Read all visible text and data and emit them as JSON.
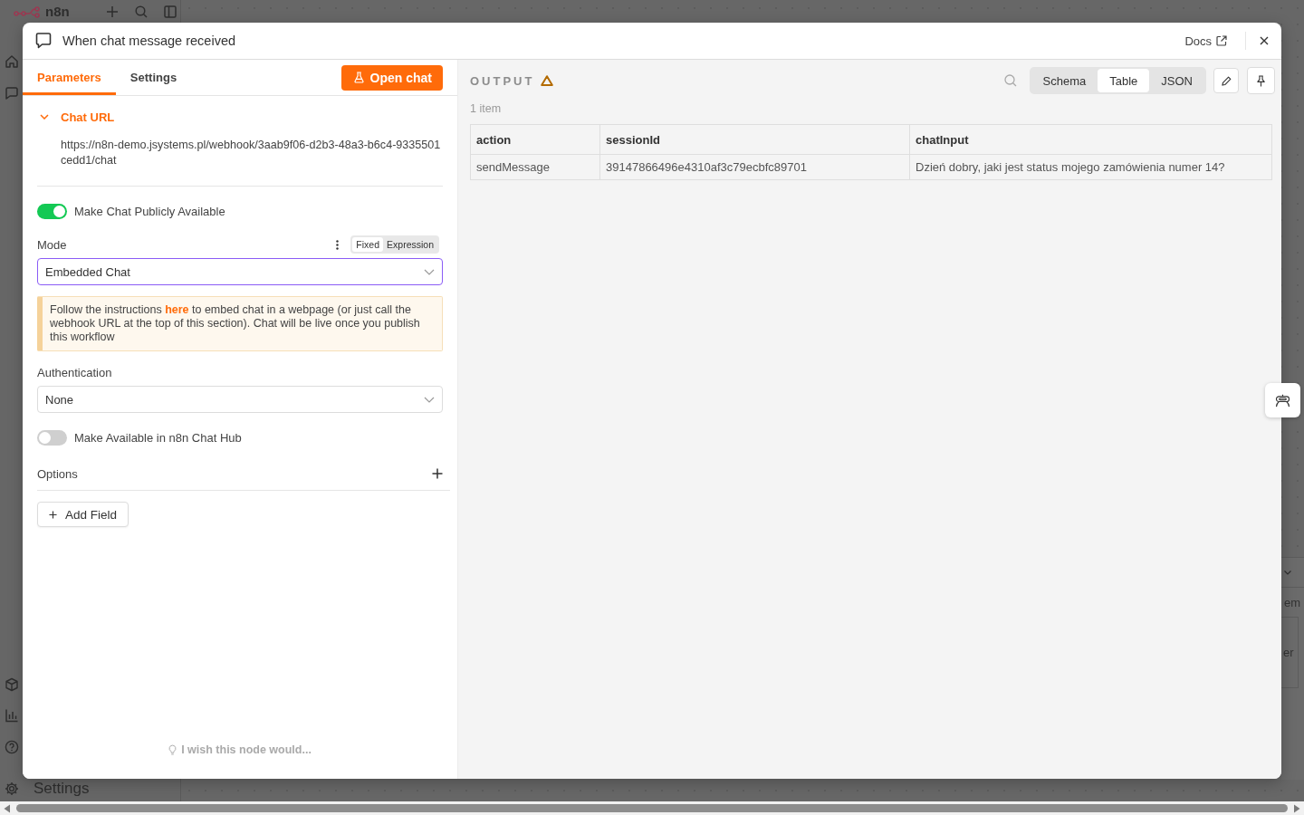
{
  "background": {
    "app_name": "n8n",
    "sidebar_item": "Settings",
    "canvas_fragments": [
      "em",
      "er"
    ]
  },
  "node_modal": {
    "title": "When chat message received",
    "docs_link": "Docs",
    "tabs": [
      {
        "label": "Parameters",
        "selected": true
      },
      {
        "label": "Settings",
        "selected": false
      }
    ],
    "open_chat_button": "Open chat",
    "chat_url": {
      "label": "Chat URL",
      "expanded": true,
      "url": "https://n8n-demo.jsystems.pl/webhook/3aab9f06-d2b3-48a3-b6c4-9335501cedd1/chat"
    },
    "parameters": [
      {
        "kind": "toggle",
        "label": "Make Chat Publicly Available",
        "on": true
      },
      {
        "kind": "select",
        "label": "Mode",
        "value": "Embedded Chat",
        "focused": true,
        "value_modes": [
          {
            "label": "Fixed",
            "selected": true
          },
          {
            "label": "Expression",
            "selected": false
          }
        ]
      },
      {
        "kind": "notice",
        "text_before": "Follow the instructions",
        "link": "here",
        "text_after": "to embed chat in a webpage (or just call the webhook URL at the top of this section). Chat will be live once you publish this workflow"
      },
      {
        "kind": "select",
        "label": "Authentication",
        "value": "None",
        "focused": false
      },
      {
        "kind": "toggle",
        "label": "Make Available in n8n Chat Hub",
        "on": false
      },
      {
        "kind": "collection",
        "label": "Options",
        "add_button": "Add Field"
      }
    ],
    "feedback_prompt": "I wish this node would..."
  },
  "output": {
    "title": "OUTPUT",
    "warning": true,
    "views": [
      {
        "label": "Schema",
        "selected": false
      },
      {
        "label": "Table",
        "selected": true
      },
      {
        "label": "JSON",
        "selected": false
      }
    ],
    "item_count": "1 item",
    "table": {
      "columns": [
        "action",
        "sessionId",
        "chatInput"
      ],
      "rows": [
        [
          "sendMessage",
          "39147866496e4310af3c79ecbfc89701",
          "Dzień dobry, jaki jest status mojego zamówienia numer 14?"
        ]
      ]
    }
  }
}
